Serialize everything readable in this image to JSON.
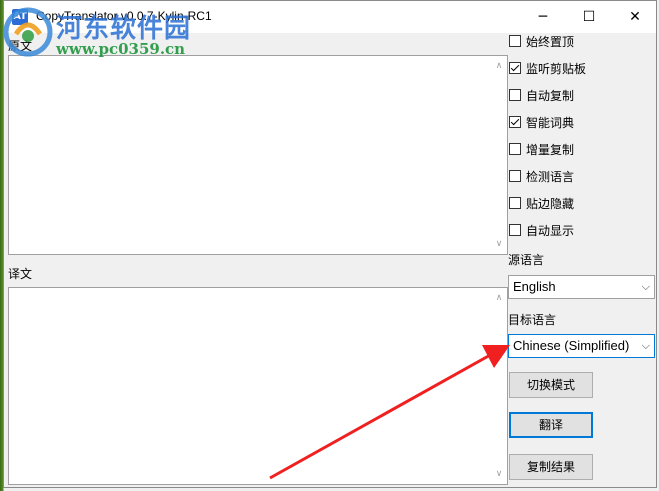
{
  "window": {
    "app_icon": "AT",
    "title": "CopyTranslator v0.0.7-Kylin-RC1",
    "minimize_glyph": "─",
    "maximize_glyph": "☐",
    "close_glyph": "✕"
  },
  "watermark": {
    "line1": "河东软件园",
    "line2": "www.pc0359.cn"
  },
  "source_label": "原文",
  "target_label": "译文",
  "source_text": "",
  "target_text": "",
  "options": [
    {
      "label": "始终置顶",
      "checked": false
    },
    {
      "label": "监听剪贴板",
      "checked": true
    },
    {
      "label": "自动复制",
      "checked": false
    },
    {
      "label": "智能词典",
      "checked": true
    },
    {
      "label": "增量复制",
      "checked": false
    },
    {
      "label": "检测语言",
      "checked": false
    },
    {
      "label": "贴边隐藏",
      "checked": false
    },
    {
      "label": "自动显示",
      "checked": false
    }
  ],
  "source_lang_label": "源语言",
  "source_lang_value": "English",
  "target_lang_label": "目标语言",
  "target_lang_value": "Chinese (Simplified)",
  "buttons": {
    "switch_mode": "切换模式",
    "translate": "翻译",
    "copy_result": "复制结果"
  },
  "colors": {
    "annotation_arrow": "#f02020",
    "focus_border": "#0078d7"
  }
}
